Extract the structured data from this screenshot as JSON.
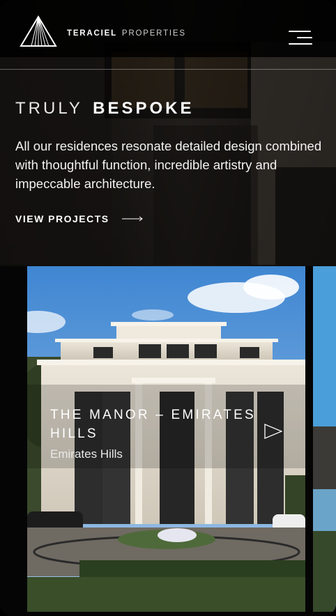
{
  "header": {
    "brand_bold": "TERACIEL",
    "brand_light": "PROPERTIES",
    "logo_icon": "triangle-logo-icon",
    "menu_icon": "hamburger-menu-icon"
  },
  "hero": {
    "title_light": "TRULY",
    "title_bold": "BESPOKE",
    "description": "All our residences resonate detailed design combined with thoughtful function, incredible artistry and impeccable architecture.",
    "cta_label": "VIEW PROJECTS",
    "cta_icon": "long-arrow-right-icon"
  },
  "projects": [
    {
      "title": "THE MANOR – EMIRATES HILLS",
      "location": "Emirates Hills",
      "icon": "play-triangle-icon"
    }
  ],
  "colors": {
    "background": "#000000",
    "text": "#ffffff",
    "sky": "#5b97d6"
  }
}
